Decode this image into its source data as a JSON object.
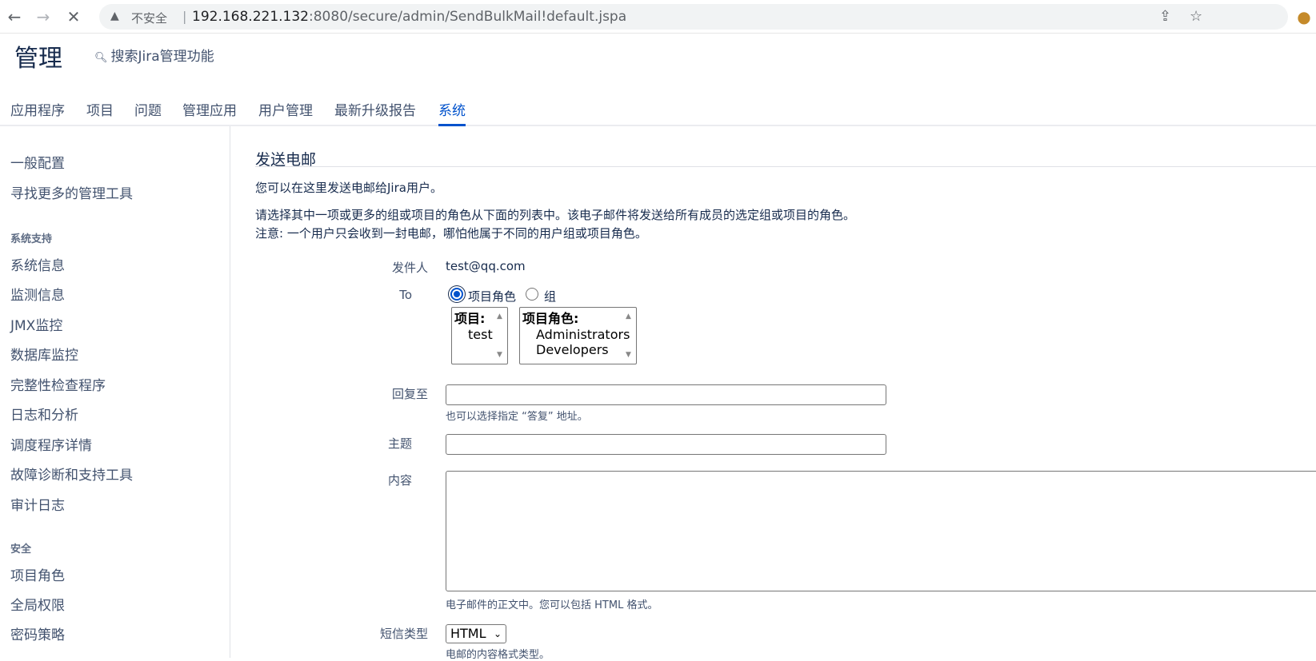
{
  "browser": {
    "insecure_label": "不安全",
    "url_host": "192.168.221.132",
    "url_rest": ":8080/secure/admin/SendBulkMail!default.jspa"
  },
  "header": {
    "title": "管理",
    "search_placeholder": "搜索Jira管理功能"
  },
  "tabs": [
    {
      "label": "应用程序"
    },
    {
      "label": "项目"
    },
    {
      "label": "问题"
    },
    {
      "label": "管理应用"
    },
    {
      "label": "用户管理"
    },
    {
      "label": "最新升级报告"
    },
    {
      "label": "系统"
    }
  ],
  "sidebar": {
    "top_items": [
      "一般配置",
      "寻找更多的管理工具"
    ],
    "section_support": "系统支持",
    "support_items": [
      "系统信息",
      "监测信息",
      "JMX监控",
      "数据库监控",
      "完整性检查程序",
      "日志和分析",
      "调度程序详情",
      "故障诊断和支持工具",
      "审计日志"
    ],
    "section_security": "安全",
    "security_items": [
      "项目角色",
      "全局权限",
      "密码策略"
    ]
  },
  "main": {
    "heading": "发送电邮",
    "intro": "您可以在这里发送电邮给Jira用户。",
    "note1": "请选择其中一项或更多的组或项目的角色从下面的列表中。该电子邮件将发送给所有成员的选定组或项目的角色。",
    "note2": "注意: 一个用户只会收到一封电邮，哪怕他属于不同的用户组或项目角色。",
    "from_label": "发件人",
    "from_value": "test@qq.com",
    "to_label": "To",
    "radio_project_role": "项目角色",
    "radio_group": "组",
    "projects_header": "项目:",
    "projects": [
      "test"
    ],
    "roles_header": "项目角色:",
    "roles": [
      "Administrators",
      "Developers"
    ],
    "reply_label": "回复至",
    "reply_value": "",
    "reply_hint": "也可以选择指定 “答复” 地址。",
    "subject_label": "主题",
    "subject_value": "",
    "body_label": "内容",
    "body_value": "",
    "body_hint": "电子邮件的正文中。您可以包括 HTML 格式。",
    "type_label": "短信类型",
    "type_value": "HTML",
    "type_hint": "电邮的内容格式类型。"
  }
}
